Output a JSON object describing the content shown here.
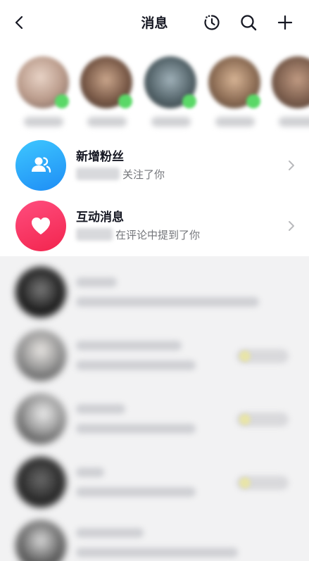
{
  "header": {
    "title": "消息",
    "back_icon": "chevron-left-icon",
    "history_icon": "history-icon",
    "search_icon": "search-icon",
    "add_icon": "plus-icon"
  },
  "stories": {
    "count": 5,
    "online_color": "#5ad867"
  },
  "system_rows": [
    {
      "title": "新增粉丝",
      "subtitle": "关注了你",
      "icon": "users-icon",
      "icon_color": "#2aa8fb"
    },
    {
      "title": "互动消息",
      "subtitle": "在评论中提到了你",
      "icon": "heart-icon",
      "icon_color": "#f5335f"
    }
  ],
  "colors": {
    "text_primary": "#161823",
    "text_secondary": "#73757a",
    "background": "#ffffff",
    "blurred_list_bg": "#f2f2f3"
  }
}
